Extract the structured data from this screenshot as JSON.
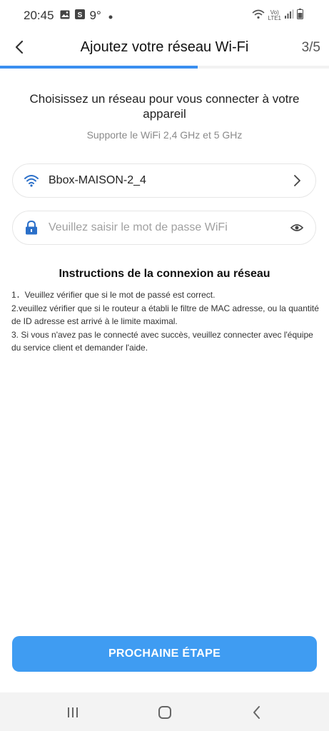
{
  "status_bar": {
    "time": "20:45",
    "temperature": "9°",
    "icons": [
      "gallery-icon",
      "s-app-icon",
      "dot-icon",
      "wifi-calling-icon",
      "volte-lte-icon",
      "signal-icon",
      "battery-icon"
    ],
    "volte_text": "Vo)",
    "lte_text": "LTE1"
  },
  "header": {
    "title": "Ajoutez votre réseau Wi-Fi",
    "step": "3/5",
    "progress": 0.6
  },
  "main": {
    "heading": "Choisissez un réseau pour vous connecter à votre appareil",
    "subtext": "Supporte le WiFi 2,4 GHz et 5 GHz",
    "network_field": {
      "value": "Bbox-MAISON-2_4"
    },
    "password_field": {
      "placeholder": "Veuillez saisir le mot de passe WiFi",
      "value": ""
    },
    "instructions": {
      "title": "Instructions de la connexion au réseau",
      "items": [
        "1．Veuillez vérifier que si le mot de passé est correct.",
        "2.veuillez vérifier que si le routeur a établi le filtre de MAC adresse, ou la quantité de ID adresse est arrivé à le limite maximal.",
        "3. Si vous n'avez pas le connecté avec succès, veuillez connecter avec l'équipe du service client et demander l'aide."
      ]
    },
    "next_button": "PROCHAINE ÉTAPE"
  },
  "colors": {
    "accent": "#3f9cf2",
    "progress": "#3b8ff0",
    "icon_blue": "#2a6fc9"
  },
  "nav_bar": {
    "buttons": [
      "recent-apps-icon",
      "home-icon",
      "back-icon"
    ]
  }
}
